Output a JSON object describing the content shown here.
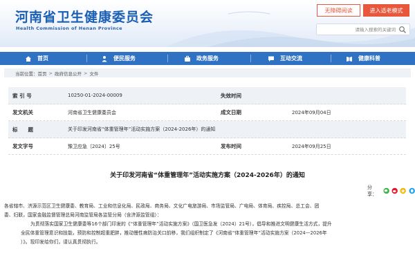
{
  "header": {
    "logo_cn": "河南省卫生健康委员会",
    "logo_en": "Health Commission of Henan Province",
    "accessible_label": "无障碍阅读",
    "elder_mode_label": "进入适老模式",
    "search_placeholder": "请输入搜索的关键词"
  },
  "nav": {
    "items": [
      {
        "label": "首页",
        "icon": "home-icon"
      },
      {
        "label": "便民服务",
        "icon": "people-icon"
      },
      {
        "label": "政务服务",
        "icon": "briefcase-icon"
      },
      {
        "label": "互动交流",
        "icon": "chat-icon"
      },
      {
        "label": "健康科普",
        "icon": "book-icon"
      }
    ]
  },
  "breadcrumb": {
    "prefix": "当前位置：",
    "items": [
      "首页",
      "政府信息公开",
      "文件"
    ],
    "separator": ">"
  },
  "info": {
    "index_label": "索 引 号",
    "index_value": "10250-01-2024-00009",
    "expiry_label": "失效时间",
    "expiry_value": "",
    "issuer_label": "发文机关",
    "issuer_value": "河南省卫生健康委员会",
    "created_label": "成文日期",
    "created_value": "2024年09月04日",
    "title_label": "标　　题",
    "title_value": "关于印发河南省“体重管理年”活动实施方案（2024-2026年）的通知",
    "docno_label": "发文字号",
    "docno_value": "豫卫应急〔2024〕25号",
    "published_label": "发布时间",
    "published_value": "2024年09月25日"
  },
  "article": {
    "title": "关于印发河南省“体重管理年”活动实施方案（2024-2026年）的通知",
    "share_label": "分享：",
    "share_icons": [
      "wechat-icon",
      "weibo-icon",
      "qzone-icon",
      "qq-icon"
    ],
    "paragraphs": [
      "各省辖市、济源示范区卫生健康委、教育局、工业和信息化局、民政局、商务局、文化广电旅游局、市场监管局、广电局、体育局、疾控局、总工会、团",
      "委、妇联，国家金融监督管理总局河南监管局各监管分局（含济源监管组）：",
      "为贯彻落实国家卫生健康委等16个部门印发的《“体重管理年”活动实施方案》（国卫医急发〔2024〕21号），倡导和推进文明健康生活方式，提升",
      "全民体重管理意识和技能，预防和控制超重肥胖，推动慢性病防治关口前移，我们组织制定了《河南省“体重管理年”活动实施方案（2024—2026年",
      "）》。现印发给你们，请认真贯彻执行。"
    ]
  },
  "colors": {
    "brand_blue": "#2f72c4",
    "logo_blue": "#1a5fb4",
    "accent_orange": "#e8573b"
  }
}
